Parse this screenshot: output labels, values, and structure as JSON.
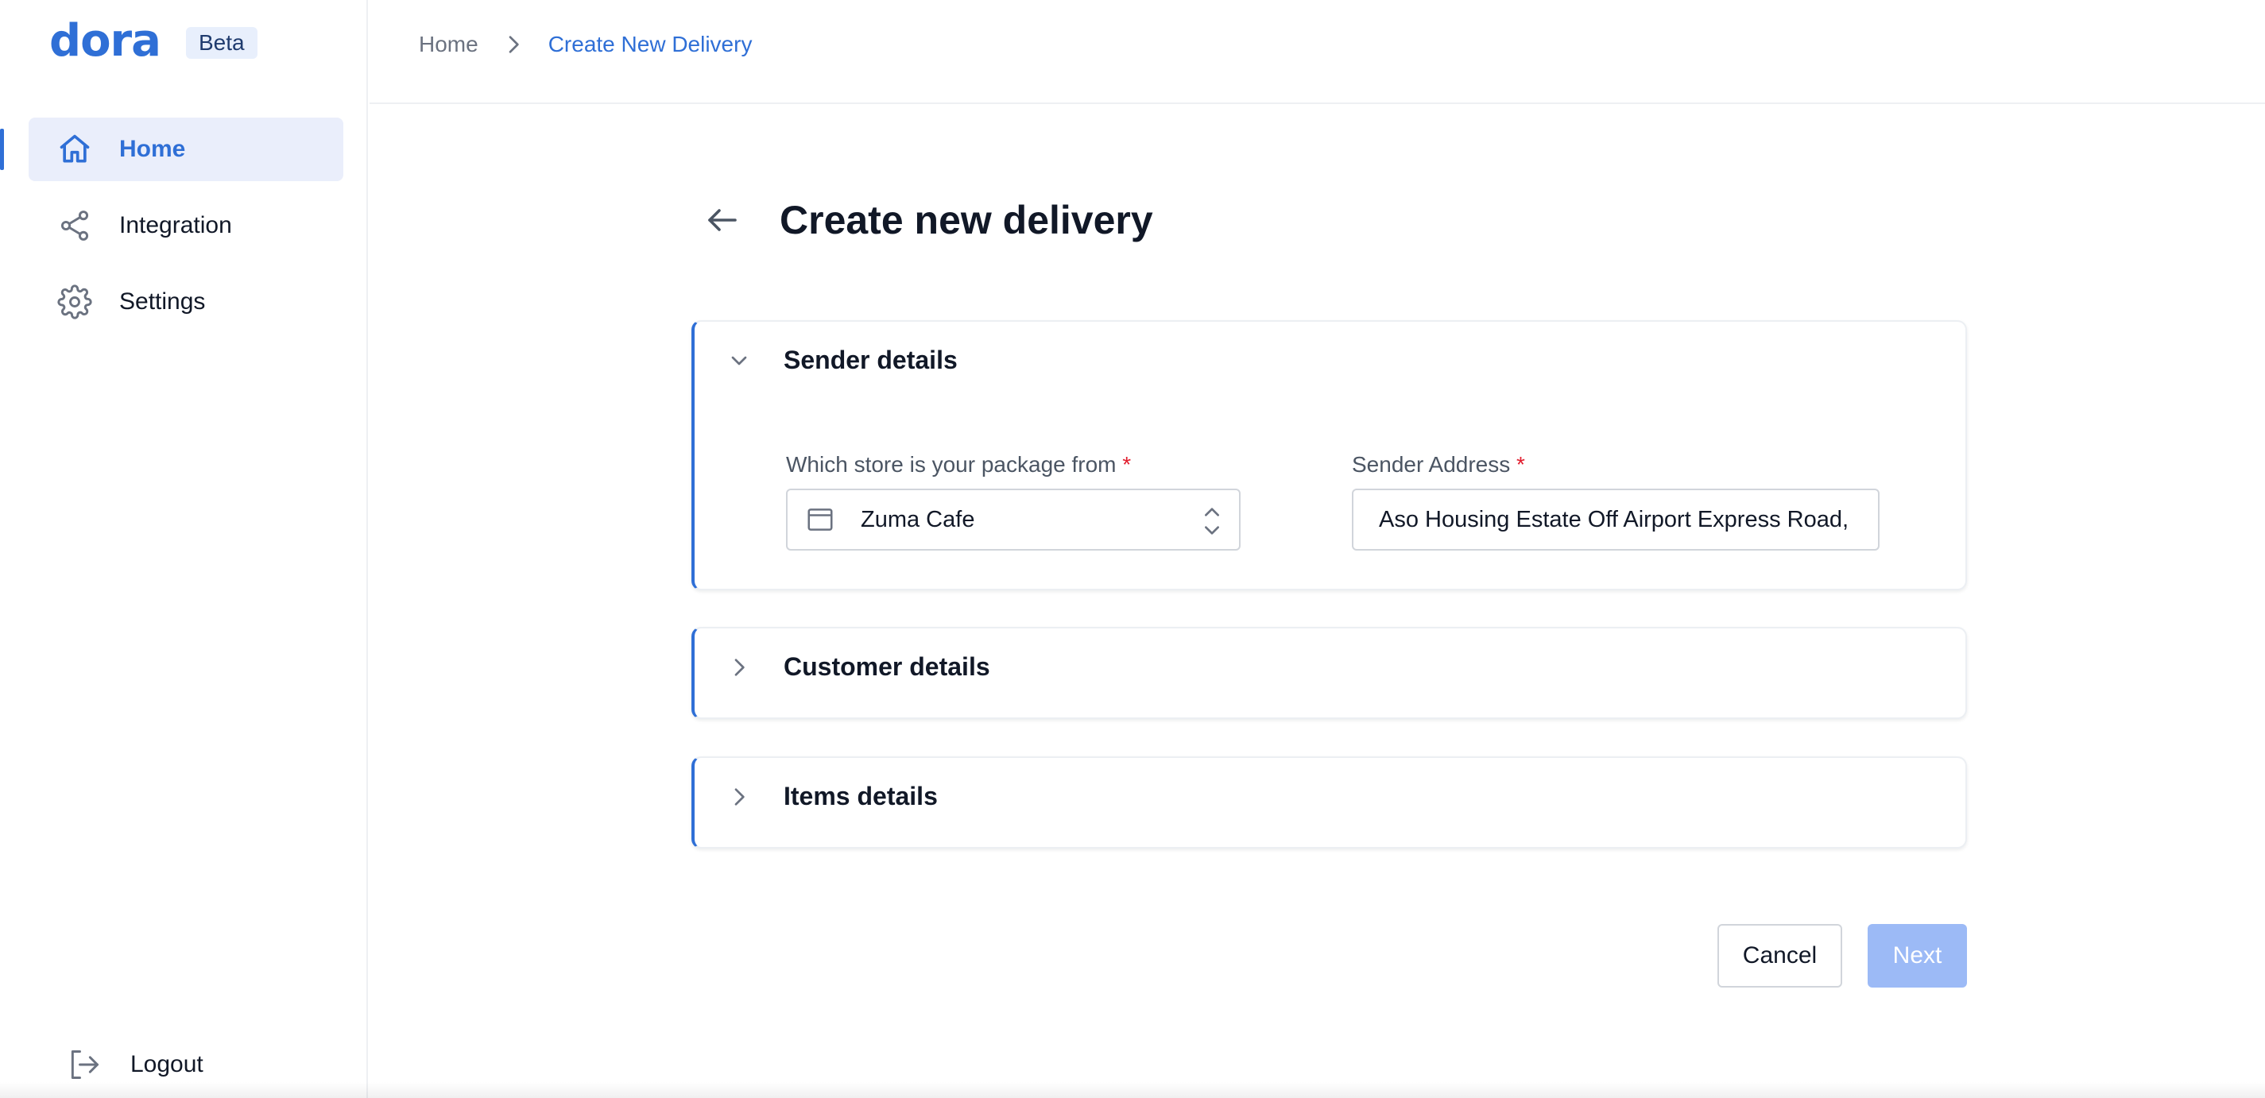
{
  "app": {
    "logo": "dora",
    "badge": "Beta"
  },
  "sidebar": {
    "items": [
      {
        "label": "Home",
        "icon": "home-icon",
        "active": true
      },
      {
        "label": "Integration",
        "icon": "share-icon",
        "active": false
      },
      {
        "label": "Settings",
        "icon": "gear-icon",
        "active": false
      }
    ],
    "logout_label": "Logout"
  },
  "breadcrumb": {
    "home": "Home",
    "current": "Create New Delivery"
  },
  "page": {
    "title": "Create new delivery"
  },
  "sections": {
    "sender": {
      "title": "Sender details",
      "expanded": true,
      "store_label": "Which store is your package from",
      "store_value": "Zuma Cafe",
      "address_label": "Sender Address",
      "address_value": "Aso Housing Estate Off Airport Express Road, Ni",
      "required_mark": "*"
    },
    "customer": {
      "title": "Customer details",
      "expanded": false
    },
    "items": {
      "title": "Items details",
      "expanded": false
    }
  },
  "actions": {
    "cancel": "Cancel",
    "next": "Next"
  },
  "colors": {
    "accent": "#2f6fd6",
    "active_bg": "#eaeefb",
    "next_disabled": "#9cbaf6",
    "required": "#e11d2e"
  }
}
